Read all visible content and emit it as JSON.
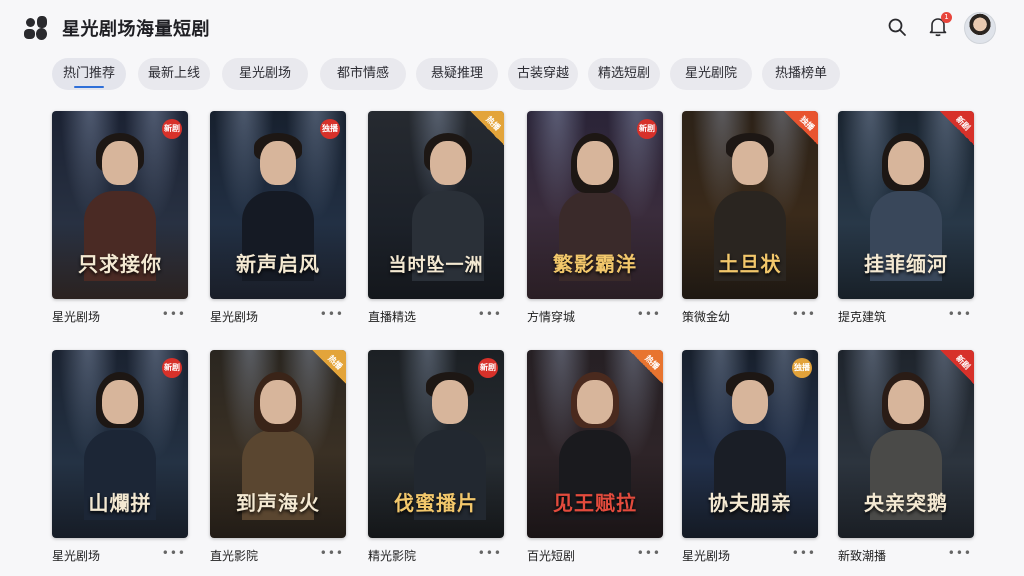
{
  "app": {
    "title": "星光剧场海量短剧"
  },
  "header": {
    "notification_count": "1"
  },
  "tabs": [
    {
      "label": "热门推荐"
    },
    {
      "label": "最新上线"
    },
    {
      "label": "星光剧场"
    },
    {
      "label": "都市情感"
    },
    {
      "label": "悬疑推理"
    },
    {
      "label": "古装穿越"
    },
    {
      "label": "精选短剧"
    },
    {
      "label": "星光剧院"
    },
    {
      "label": "热播榜单"
    }
  ],
  "cards": [
    {
      "poster_title": "只求接你",
      "badge": "新剧",
      "label": "星光剧场"
    },
    {
      "poster_title": "新声启风",
      "badge": "独播",
      "label": "星光剧场"
    },
    {
      "poster_title": "当时坠一洲",
      "badge": "热播",
      "label": "直播精选"
    },
    {
      "poster_title": "繁影霸洋",
      "badge": "新剧",
      "label": "方情穿城"
    },
    {
      "poster_title": "土旦状",
      "badge": "独播",
      "label": "策微金幼"
    },
    {
      "poster_title": "挂菲缅河",
      "badge": "新剧",
      "label": "提克建筑"
    },
    {
      "poster_title": "山爛拼",
      "badge": "新剧",
      "label": "星光剧场"
    },
    {
      "poster_title": "到声海火",
      "badge": "热播",
      "label": "直光影院"
    },
    {
      "poster_title": "伐蜜播片",
      "badge": "新剧",
      "label": "精光影院"
    },
    {
      "poster_title": "见王赋拉",
      "badge": "热播",
      "label": "百光短剧"
    },
    {
      "poster_title": "协夫朋亲",
      "badge": "独播",
      "label": "星光剧场"
    },
    {
      "poster_title": "央亲突鹅",
      "badge": "新剧",
      "label": "新致潮播"
    }
  ]
}
